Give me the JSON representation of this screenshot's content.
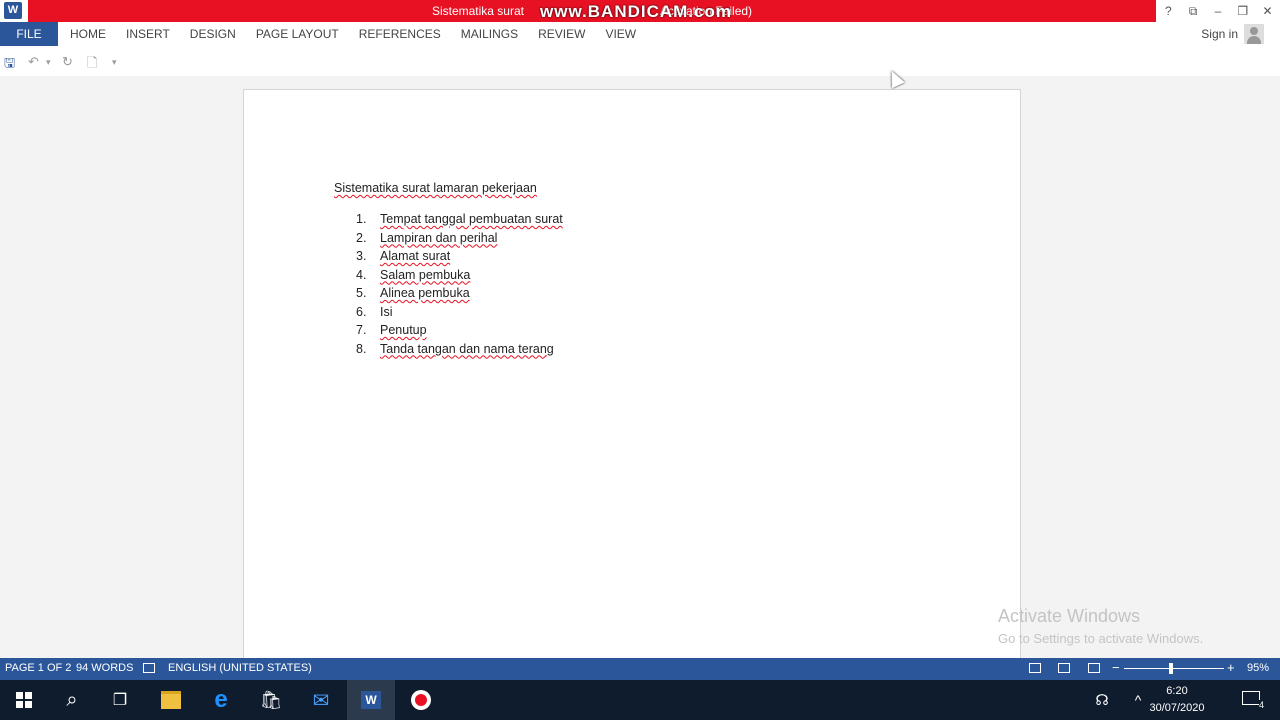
{
  "window": {
    "title": "Sistematika surat",
    "title_suffix": "Activation Failed)",
    "watermark": "www.BANDICAM.com",
    "word_icon_letter": "W"
  },
  "controls": {
    "help": "?",
    "ribbon_toggle": "⧉",
    "minimize": "–",
    "restore": "❐",
    "close": "✕"
  },
  "menu": {
    "file": "FILE",
    "tabs": [
      "HOME",
      "INSERT",
      "DESIGN",
      "PAGE LAYOUT",
      "REFERENCES",
      "MAILINGS",
      "REVIEW",
      "VIEW"
    ],
    "sign_in": "Sign in"
  },
  "qat": {
    "save": "🖫",
    "undo": "↶",
    "undo_dropdown": "▾",
    "redo": "↻",
    "new": "🗋",
    "customize": "▾"
  },
  "document": {
    "title": "Sistematika surat lamaran pekerjaan",
    "items": [
      {
        "num": "1.",
        "text": "Tempat tanggal pembuatan surat"
      },
      {
        "num": "2.",
        "text": "Lampiran dan perihal"
      },
      {
        "num": "3.",
        "text": "Alamat surat"
      },
      {
        "num": "4.",
        "text": "Salam pembuka"
      },
      {
        "num": "5.",
        "text": "Alinea pembuka"
      },
      {
        "num": "6.",
        "text": "Isi"
      },
      {
        "num": "7.",
        "text": "Penutup"
      },
      {
        "num": "8.",
        "text": "Tanda tangan dan nama terang"
      }
    ]
  },
  "activation": {
    "line1": "Activate Windows",
    "line2": "Go to Settings to activate Windows."
  },
  "status": {
    "page": "PAGE 1 OF 2",
    "words": "94 WORDS",
    "language": "ENGLISH (UNITED STATES)",
    "zoom_minus": "−",
    "zoom_plus": "+",
    "zoom": "95%"
  },
  "taskbar": {
    "search_icon": "⌕",
    "task_view_icon": "❐",
    "edge_icon": "e",
    "store_icon": "🛍",
    "mail_icon": "✉",
    "word_icon": "W",
    "record_icon": "●",
    "people_icon": "☊",
    "tray_chevron": "^",
    "time": "6:20",
    "date": "30/07/2020",
    "notification_count": "4"
  },
  "colors": {
    "title_bar": "#e81123",
    "word_blue": "#2b579a",
    "taskbar": "#0f1c2e"
  }
}
